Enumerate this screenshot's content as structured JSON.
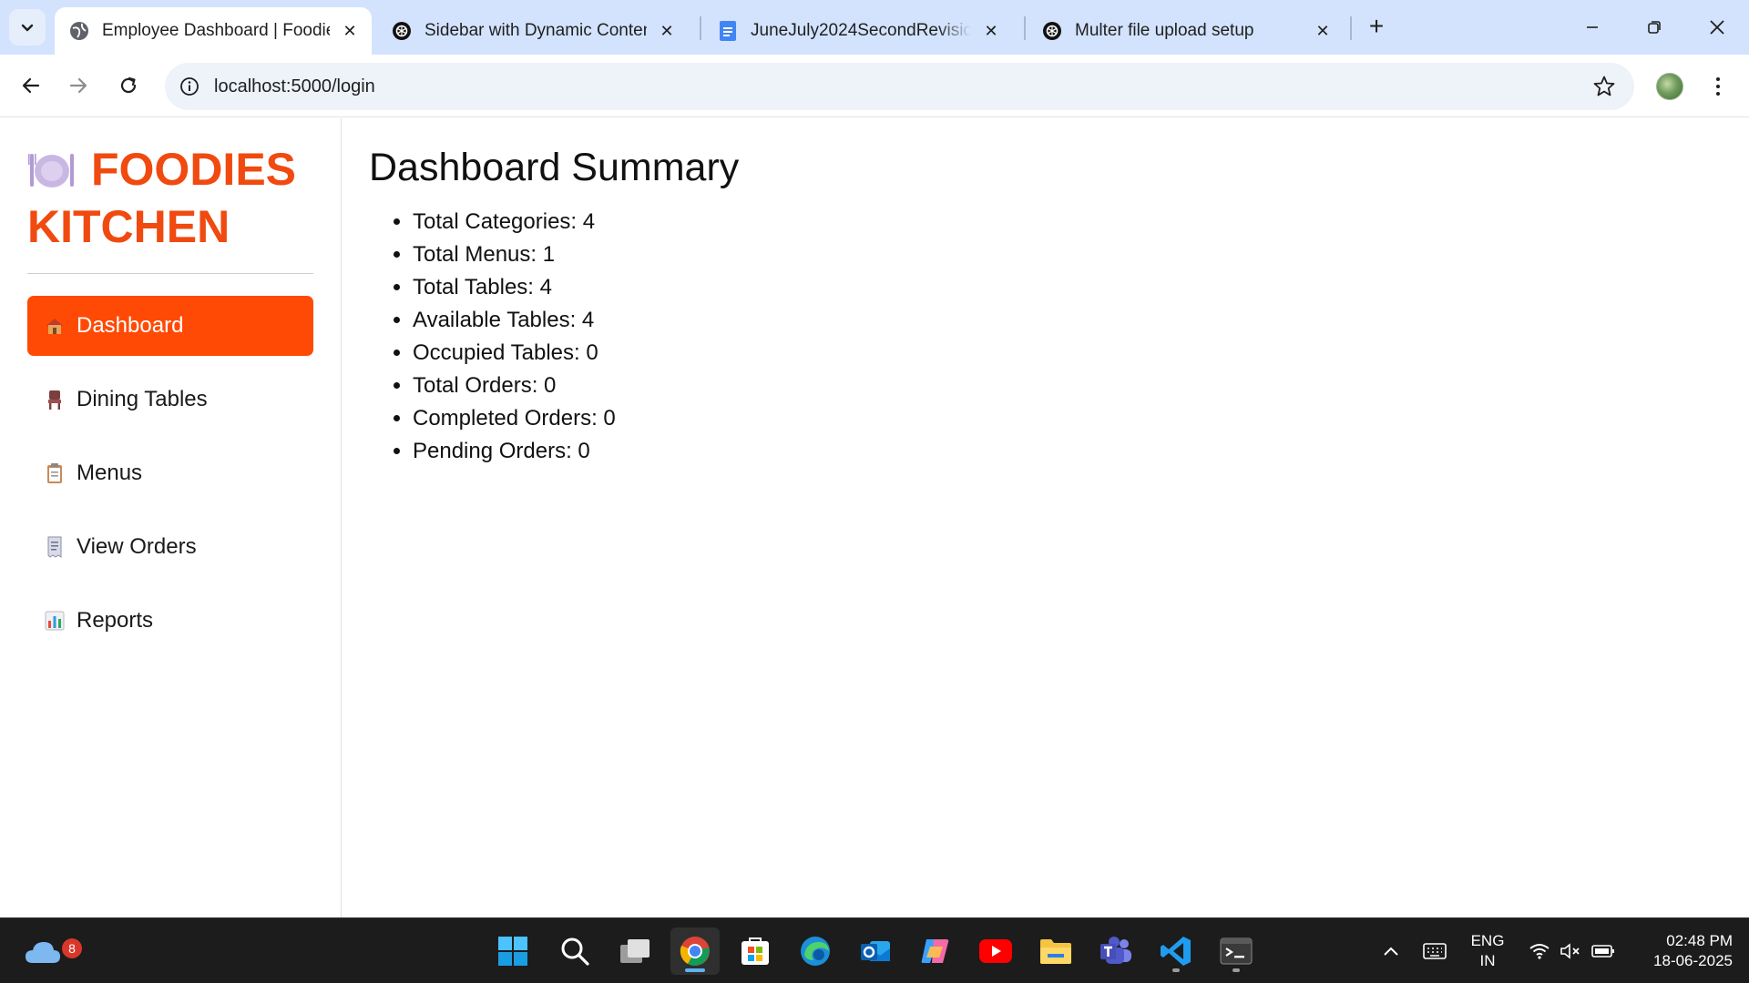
{
  "browser": {
    "tabs": [
      {
        "title": "Employee Dashboard | Foodies",
        "active": true,
        "favicon": "globe-icon"
      },
      {
        "title": "Sidebar with Dynamic Content",
        "active": false,
        "favicon": "openai-icon"
      },
      {
        "title": "JuneJuly2024SecondRevisionPla",
        "active": false,
        "favicon": "google-docs-icon"
      },
      {
        "title": "Multer file upload setup",
        "active": false,
        "favicon": "openai-icon"
      }
    ],
    "url": "localhost:5000/login"
  },
  "sidebar": {
    "brand": {
      "icon": "plate-cutlery-icon",
      "line1": "FOODIES",
      "line2": "KITCHEN"
    },
    "items": [
      {
        "label": "Dashboard",
        "icon": "house-icon",
        "active": true
      },
      {
        "label": "Dining Tables",
        "icon": "chair-icon",
        "active": false
      },
      {
        "label": "Menus",
        "icon": "clipboard-icon",
        "active": false
      },
      {
        "label": "View Orders",
        "icon": "receipt-icon",
        "active": false
      },
      {
        "label": "Reports",
        "icon": "bar-chart-icon",
        "active": false
      }
    ]
  },
  "main": {
    "title": "Dashboard Summary",
    "summary": [
      "Total Categories: 4",
      "Total Menus: 1",
      "Total Tables: 4",
      "Available Tables: 4",
      "Occupied Tables: 0",
      "Total Orders: 0",
      "Completed Orders: 0",
      "Pending Orders: 0"
    ]
  },
  "taskbar": {
    "weather_badge": "8",
    "apps": [
      "start",
      "search",
      "task-view",
      "chrome",
      "microsoft-store",
      "edge",
      "outlook",
      "copilot",
      "youtube",
      "file-explorer",
      "teams",
      "vscode",
      "terminal"
    ],
    "language": {
      "line1": "ENG",
      "line2": "IN"
    },
    "clock": {
      "time": "02:48 PM",
      "date": "18-06-2025"
    }
  },
  "colors": {
    "accent": "#ff4a05",
    "brand": "#f04a10",
    "tabstrip": "#d3e3fd"
  }
}
